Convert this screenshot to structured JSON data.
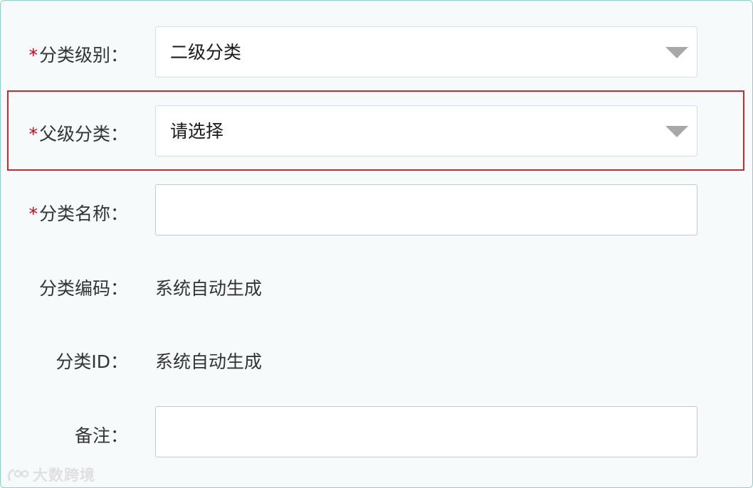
{
  "form": {
    "category_level": {
      "label": "分类级别：",
      "required_mark": "*",
      "value": "二级分类"
    },
    "parent_category": {
      "label": "父级分类：",
      "required_mark": "*",
      "placeholder": "请选择"
    },
    "category_name": {
      "label": "分类名称：",
      "required_mark": "*",
      "value": ""
    },
    "category_code": {
      "label": "分类编码：",
      "value": "系统自动生成"
    },
    "category_id": {
      "label": "分类ID：",
      "value": "系统自动生成"
    },
    "remark": {
      "label": "备注：",
      "value": ""
    }
  },
  "watermark": {
    "text": "大数跨境"
  },
  "colors": {
    "required": "#d0021b",
    "highlight_border": "#d0272f",
    "frame_border": "#8fd0c8"
  }
}
